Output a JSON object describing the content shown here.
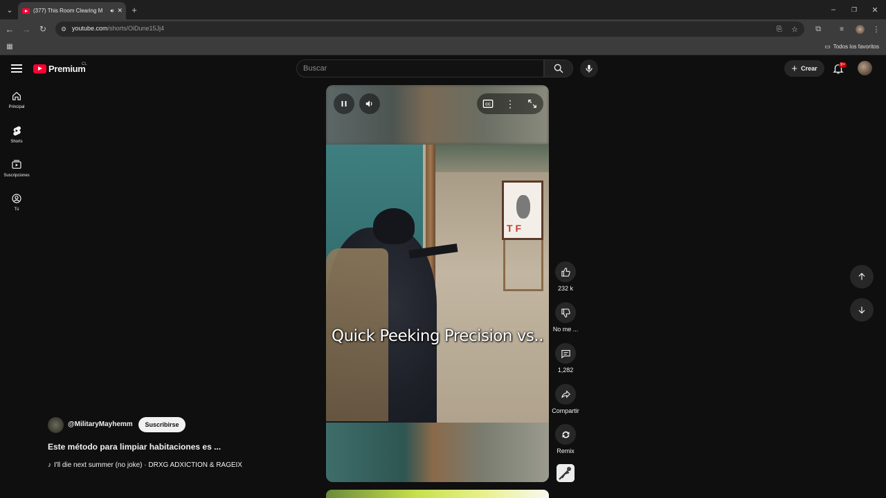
{
  "browser": {
    "tab_title": "(377) This Room Clearing M",
    "url_host": "youtube.com",
    "url_path": "/shorts/OiDune15Jj4",
    "bookmarks_all": "Todos los favoritos"
  },
  "header": {
    "logo_text": "Premium",
    "country": "CL",
    "search_placeholder": "Buscar",
    "create_label": "Crear",
    "notifications_badge": "9+"
  },
  "rail": {
    "items": [
      {
        "label": "Principal",
        "icon": "home-icon"
      },
      {
        "label": "Shorts",
        "icon": "shorts-icon"
      },
      {
        "label": "Suscripciones",
        "icon": "subscriptions-icon"
      },
      {
        "label": "Tú",
        "icon": "you-icon"
      }
    ]
  },
  "player": {
    "caption": "Quick Peeking Precision vs.."
  },
  "actions": {
    "likes": "232 k",
    "dislike": "No me ...",
    "comments": "1,282",
    "share": "Compartir",
    "remix": "Remix"
  },
  "info": {
    "channel": "@MilitaryMayhemm",
    "subscribe": "Suscribirse",
    "title": "Este método para limpiar habitaciones es ...",
    "music": "I'll die next summer (no joke) · DRXG ADXICTION & RAGEIX"
  },
  "colors": {
    "youtube_red": "#ff0033",
    "background": "#0f0f0f",
    "button_bg": "#272727"
  }
}
